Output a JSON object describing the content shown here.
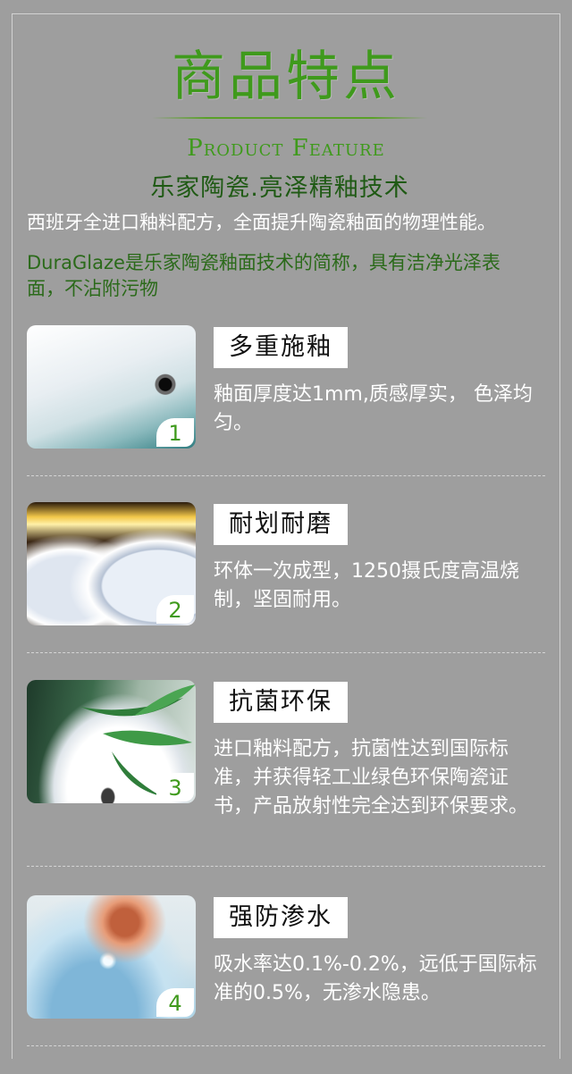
{
  "header": {
    "title": "商品特点",
    "subtitle_en": "Product Feature",
    "tagline": "乐家陶瓷.亮泽精釉技术",
    "description": "西班牙全进口釉料配方，全面提升陶瓷釉面的物理性能。",
    "duraglaze": "DuraGlaze是乐家陶瓷釉面技术的简称，具有洁净光泽表面，不沾附污物"
  },
  "features": [
    {
      "number": "1",
      "title": "多重施釉",
      "text": "釉面厚度达1mm,质感厚实，    色泽均匀。",
      "photo": "washbasin-drain-photo"
    },
    {
      "number": "2",
      "title": "耐划耐磨",
      "text": "环体一次成型，1250摄氏度高温烧制，坚固耐用。",
      "photo": "kiln-ceramic-rings-photo"
    },
    {
      "number": "3",
      "title": "抗菌环保",
      "text": "进口釉料配方，抗菌性达到国际标准，并获得轻工业绿色环保陶瓷证书，产品放射性完全达到环保要求。",
      "photo": "basin-bamboo-leaves-photo"
    },
    {
      "number": "4",
      "title": "强防渗水",
      "text": "吸水率达0.1%-0.2%，远低于国际标准的0.5%，无渗水隐患。",
      "photo": "water-droplet-finger-photo"
    }
  ],
  "colors": {
    "background": "#9e9e9e",
    "accent_green": "#3f9a1c",
    "dark_green": "#2b6a1a",
    "text_white": "#ffffff"
  }
}
